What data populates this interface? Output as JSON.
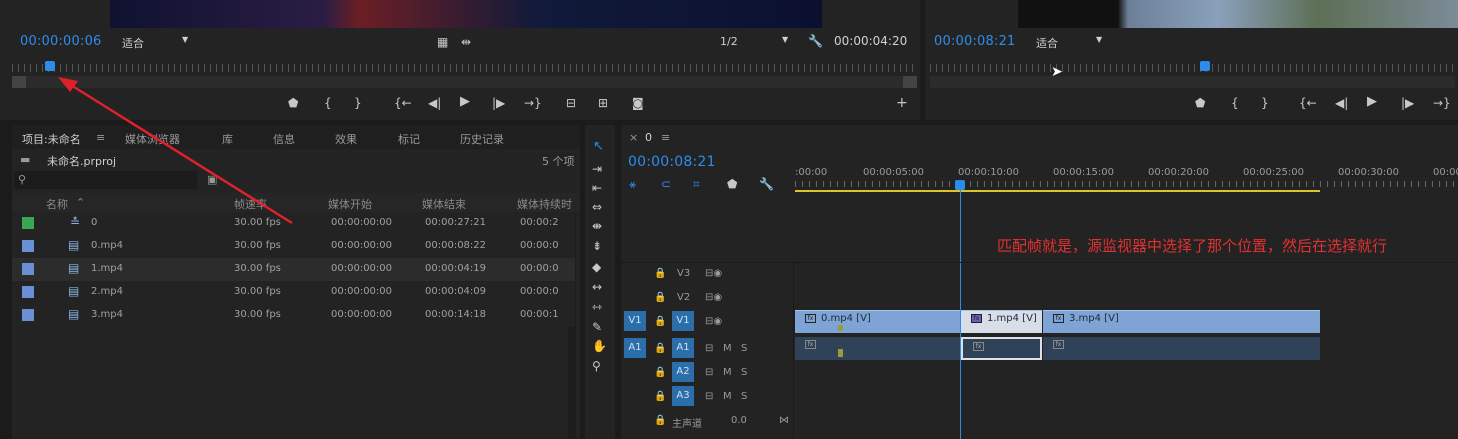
{
  "source_monitor": {
    "timecode": "00:00:00:06",
    "fit": "适合",
    "resolution": "1/2",
    "duration": "00:00:04:20"
  },
  "program_monitor": {
    "timecode": "00:00:08:21",
    "fit": "适合"
  },
  "project": {
    "tabs": [
      "项目:未命名",
      "媒体浏览器",
      "库",
      "信息",
      "效果",
      "标记",
      "历史记录"
    ],
    "file": "未命名.prproj",
    "count": "5 个项",
    "columns": [
      "名称",
      "帧速率",
      "媒体开始",
      "媒体结束",
      "媒体持续时"
    ],
    "rows": [
      {
        "name": "0",
        "fps": "30.00 fps",
        "start": "00:00:00:00",
        "end": "00:00:27:21",
        "dur": "00:00:2",
        "color": "#3aa652"
      },
      {
        "name": "0.mp4",
        "fps": "30.00 fps",
        "start": "00:00:00:00",
        "end": "00:00:08:22",
        "dur": "00:00:0",
        "color": "#6b8fd4"
      },
      {
        "name": "1.mp4",
        "fps": "30.00 fps",
        "start": "00:00:00:00",
        "end": "00:00:04:19",
        "dur": "00:00:0",
        "color": "#6b8fd4"
      },
      {
        "name": "2.mp4",
        "fps": "30.00 fps",
        "start": "00:00:00:00",
        "end": "00:00:04:09",
        "dur": "00:00:0",
        "color": "#6b8fd4"
      },
      {
        "name": "3.mp4",
        "fps": "30.00 fps",
        "start": "00:00:00:00",
        "end": "00:00:14:18",
        "dur": "00:00:1",
        "color": "#6b8fd4"
      }
    ]
  },
  "timeline": {
    "tab_x": "×",
    "tab_name": "0",
    "timecode": "00:00:08:21",
    "ruler": [
      ":00:00",
      "00:00:05:00",
      "00:00:10:00",
      "00:00:15:00",
      "00:00:20:00",
      "00:00:25:00",
      "00:00:30:00",
      "00:00"
    ],
    "tracks": {
      "v3": "V3",
      "v2": "V2",
      "v1": "V1",
      "v1src": "V1",
      "a1": "A1",
      "a1src": "A1",
      "a2": "A2",
      "a3": "A3",
      "m": "M",
      "s": "S",
      "master": "主声道",
      "master_val": "0.0"
    },
    "clips": {
      "c0": "0.mp4 [V]",
      "c1": "1.mp4 [V]",
      "c3": "3.mp4 [V]",
      "fx": "fx"
    },
    "annotation": "匹配帧就是，源监视器中选择了那个位置，然后在选择就行"
  }
}
